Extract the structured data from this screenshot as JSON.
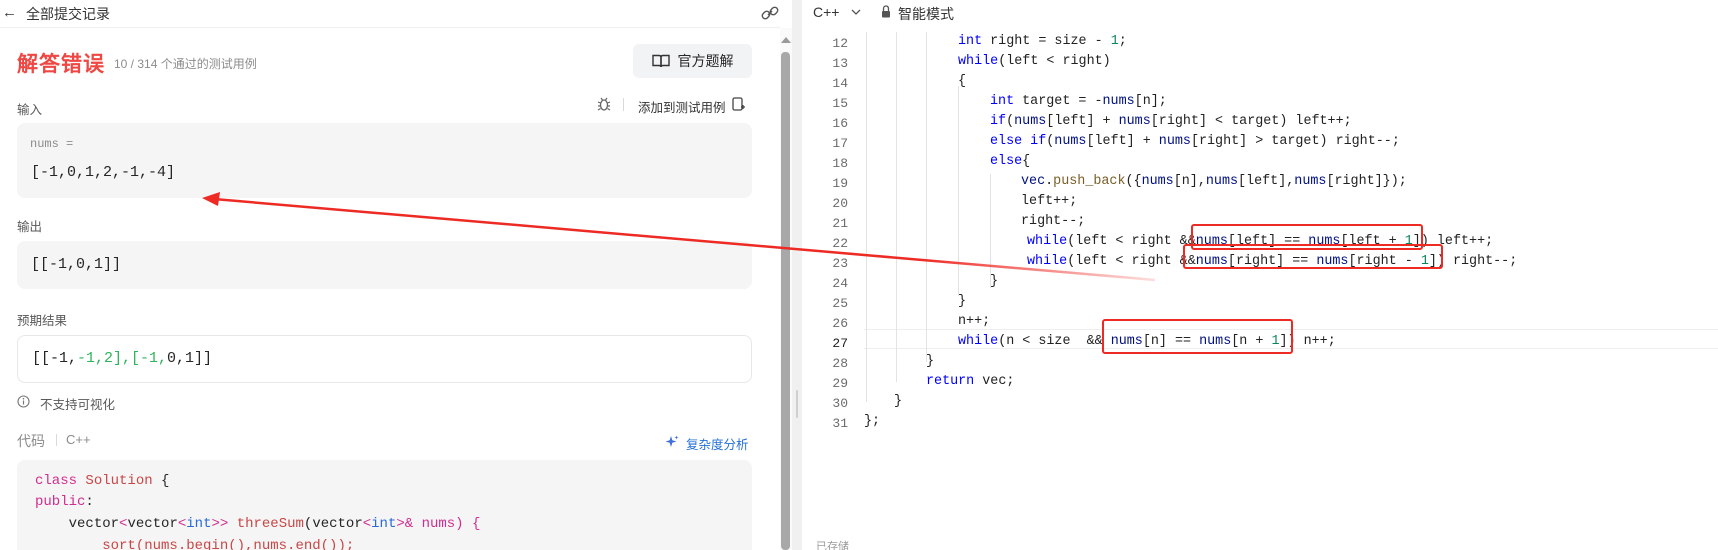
{
  "left_panel": {
    "title": "全部提交记录",
    "verdict": "解答错误",
    "verdict_detail": "10 / 314 个通过的测试用例",
    "official_solution_label": "官方题解",
    "input_label": "输入",
    "add_to_testcase_label": "添加到测试用例",
    "input_var_name": "nums =",
    "input_value": "[-1,0,1,2,-1,-4]",
    "output_label": "输出",
    "output_value": "[[-1,0,1]]",
    "expected_label": "预期结果",
    "expected_value": {
      "open": "[[-1,",
      "diff1": "-1,2],[-1,",
      "rest": "0,1]]"
    },
    "no_visualization_label": "不支持可视化",
    "code_label": "代码",
    "code_lang": "C++",
    "complexity_label": "复杂度分析",
    "code_lines": [
      {
        "kw": "class ",
        "cls": "Solution",
        "rest": " {"
      },
      {
        "kw": "public",
        "rest": ":"
      },
      {
        "indent": "    ",
        "a": "vector",
        "b": "<",
        "c": "vector",
        "d": "<",
        "e": "int",
        "f": ">> ",
        "g": "threeSum",
        "h": "(",
        "i": "vector",
        "j": "<",
        "k": "int",
        "l": ">& nums) {"
      },
      {
        "text": "        sort(nums.begin(),nums.end());"
      }
    ]
  },
  "right_panel": {
    "language": "C++",
    "mode": "智能模式",
    "saved_label": "已存储",
    "line_numbers": [
      "12",
      "13",
      "14",
      "15",
      "16",
      "17",
      "18",
      "19",
      "20",
      "21",
      "22",
      "23",
      "24",
      "25",
      "26",
      "27",
      "28",
      "29",
      "30",
      "31"
    ],
    "active_line": "27"
  },
  "icons": {
    "back": "arrow-left-icon",
    "link": "link-icon",
    "book": "book-icon",
    "debug": "bug-icon",
    "add": "add-testcase-icon",
    "info": "info-icon",
    "sparkle": "sparkle-icon",
    "chevron": "chevron-down-icon",
    "lock": "lock-icon"
  },
  "colors": {
    "verdict_red": "#ef4743",
    "annotation_red": "#ee2a24",
    "diff_green": "#2db55d",
    "link_blue": "#2370d6"
  }
}
